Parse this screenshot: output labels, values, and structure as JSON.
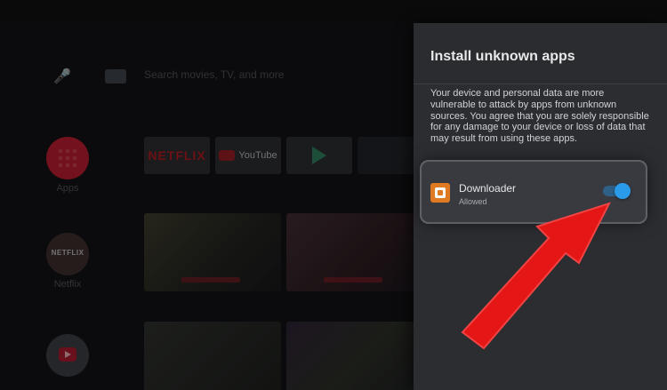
{
  "home": {
    "search_placeholder": "Search movies, TV, and more",
    "left_rail": [
      {
        "label": "Apps"
      },
      {
        "label": "Netflix"
      },
      {
        "label": ""
      }
    ],
    "apps_row": {
      "netflix_card": "NETFLIX",
      "youtube_card": "YouTube"
    }
  },
  "panel": {
    "title": "Install unknown apps",
    "description": "Your device and personal data are more vulnerable to attack by apps from unknown sources. You agree that you are solely responsible for any damage to your device or loss of data that may result from using these apps.",
    "app": {
      "name": "Downloader",
      "status": "Allowed",
      "toggle_on": true
    }
  },
  "colors": {
    "panel_bg": "#2b2d31",
    "toggle_track": "#2e5f86",
    "toggle_knob": "#2a9be8",
    "arrow": "#e51616"
  }
}
